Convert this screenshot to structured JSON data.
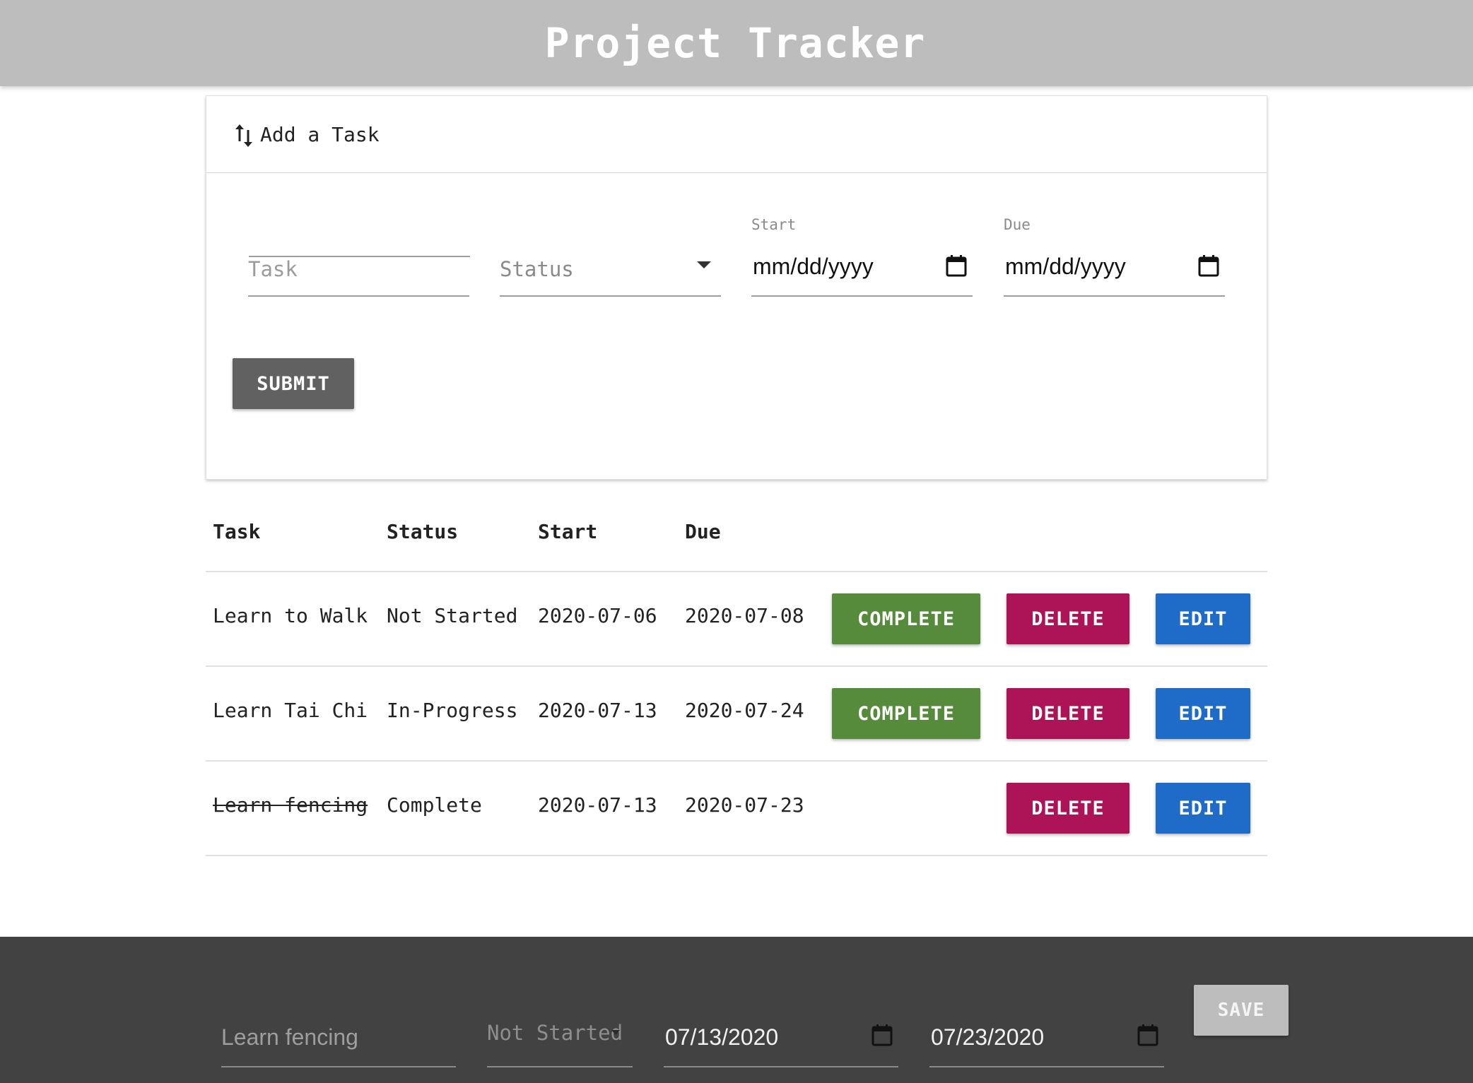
{
  "app": {
    "title": "Project Tracker",
    "colors": {
      "header_bg": "#bdbdbd",
      "footer_bg": "#424242",
      "complete": "#558b3a",
      "delete": "#ad1457",
      "edit": "#1e6cc8",
      "submit": "#616161",
      "save_disabled": "#bdbdbd"
    }
  },
  "add_task": {
    "title": "Add a Task",
    "icon": "sort-arrows-icon",
    "task_placeholder": "Task",
    "status_placeholder": "Status",
    "start_label": "Start",
    "start_value": "mm/dd/yyyy",
    "due_label": "Due",
    "due_value": "mm/dd/yyyy",
    "submit_label": "SUBMIT"
  },
  "table": {
    "headers": [
      "Task",
      "Status",
      "Start",
      "Due"
    ],
    "rows": [
      {
        "task": "Learn to Walk",
        "status": "Not Started",
        "start": "2020-07-06",
        "due": "2020-07-08",
        "complete_label": "COMPLETE",
        "delete_label": "DELETE",
        "edit_label": "EDIT",
        "struck": false
      },
      {
        "task": "Learn Tai Chi",
        "status": "In-Progress",
        "start": "2020-07-13",
        "due": "2020-07-24",
        "complete_label": "COMPLETE",
        "delete_label": "DELETE",
        "edit_label": "EDIT",
        "struck": false
      },
      {
        "task": "Learn fencing",
        "status": "Complete",
        "start": "2020-07-13",
        "due": "2020-07-23",
        "delete_label": "DELETE",
        "edit_label": "EDIT",
        "struck": true
      }
    ]
  },
  "edit_bar": {
    "task_value": "Learn fencing",
    "status_value": "Not Started",
    "start_value": "07/13/2020",
    "due_value": "07/23/2020",
    "save_label": "SAVE"
  }
}
